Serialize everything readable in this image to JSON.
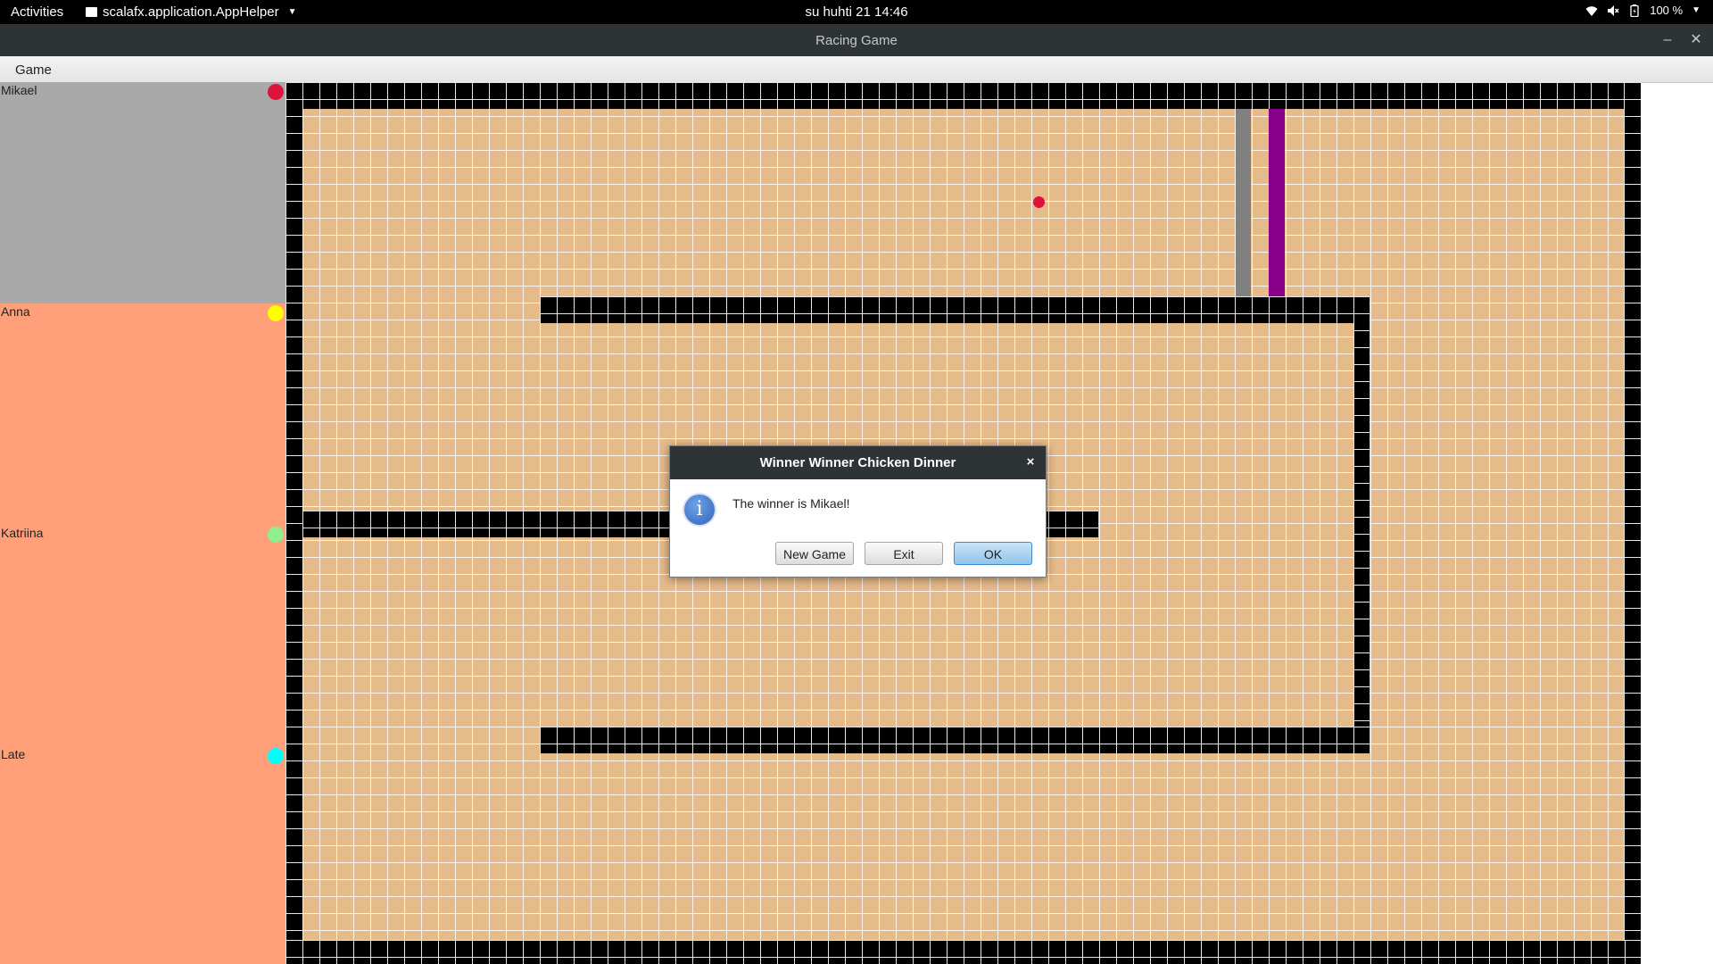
{
  "topbar": {
    "activities": "Activities",
    "app_name": "scalafx.application.AppHelper",
    "clock": "su huhti 21  14:46",
    "battery": "100 %"
  },
  "window": {
    "title": "Racing Game"
  },
  "menubar": {
    "items": [
      "Game"
    ]
  },
  "players": [
    {
      "name": "Mikael",
      "color": "#dc143c",
      "panel_color": "#a9a9a9"
    },
    {
      "name": "Anna",
      "color": "#ffff00",
      "panel_color": "#ffa07a"
    },
    {
      "name": "Katriina",
      "color": "#90ee90",
      "panel_color": "#ffa07a"
    },
    {
      "name": "Late",
      "color": "#00ffff",
      "panel_color": "#ffa07a"
    }
  ],
  "track": {
    "ground_color": "#e6bb8a",
    "wall_color": "#000000",
    "finish_line_color": "#808080",
    "start_line_color": "#8b008b",
    "car_color": "#dc143c"
  },
  "dialog": {
    "title": "Winner Winner Chicken Dinner",
    "close_glyph": "×",
    "icon": "info-icon",
    "icon_glyph": "i",
    "message": "The winner is Mikael!",
    "buttons": {
      "new_game": "New Game",
      "exit": "Exit",
      "ok": "OK"
    }
  }
}
